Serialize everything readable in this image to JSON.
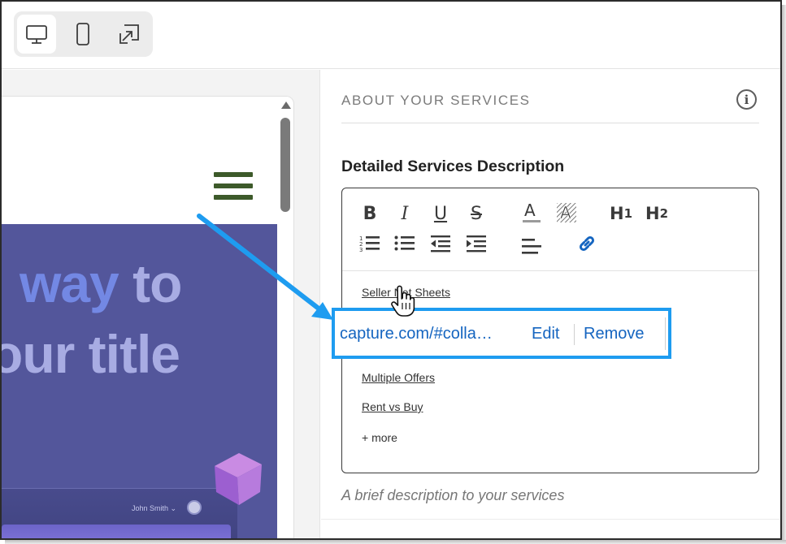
{
  "toolbar": {
    "devices": [
      {
        "name": "desktop",
        "icon": "desktop-icon",
        "active": true
      },
      {
        "name": "mobile",
        "icon": "mobile-icon",
        "active": false
      },
      {
        "name": "expand",
        "icon": "expand-icon",
        "active": false
      }
    ]
  },
  "preview": {
    "hero_line1_a": "way",
    "hero_line1_b": "to",
    "hero_line2": "our title",
    "mini_user": "John Smith",
    "hero_color": "#53569b",
    "menu_color": "#3d5a2a"
  },
  "panel": {
    "section_title": "ABOUT YOUR SERVICES",
    "field_label": "Detailed Services Description",
    "helper_text": "A brief description to your services",
    "editor": {
      "toolbar_row1": [
        "bold",
        "italic",
        "underline",
        "strikethrough",
        "font-color",
        "highlight",
        "heading-1",
        "heading-2"
      ],
      "toolbar_row2": [
        "ordered-list",
        "bullet-list",
        "outdent",
        "indent",
        "align",
        "link"
      ],
      "links": [
        "Seller Net Sheets",
        "Multiple Offers",
        "Rent vs Buy"
      ],
      "more": "+ more"
    }
  },
  "link_popup": {
    "url_text": "capture.com/#colla…",
    "edit_label": "Edit",
    "remove_label": "Remove",
    "accent": "#1e9cf0"
  }
}
